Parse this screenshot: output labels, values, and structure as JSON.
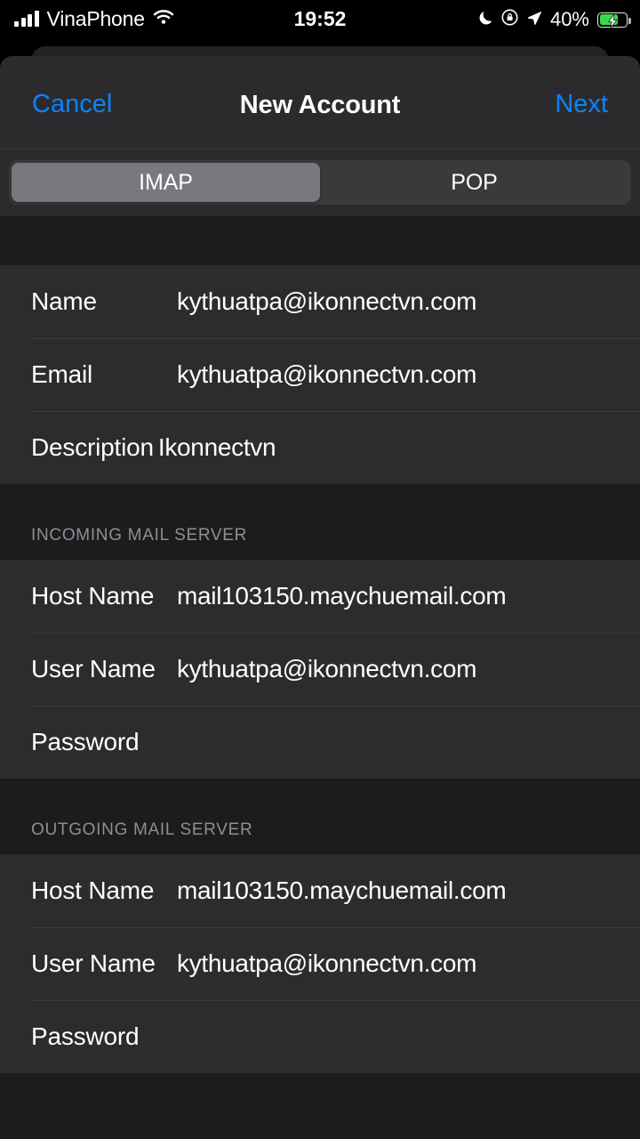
{
  "status_bar": {
    "carrier": "VinaPhone",
    "signal_icon": "signal-bars-icon",
    "wifi_icon": "wifi-icon",
    "time": "19:52",
    "do_not_disturb_icon": "crescent-moon-icon",
    "rotation_lock_icon": "rotation-lock-icon",
    "location_icon": "location-arrow-icon",
    "battery_percent": "40%",
    "battery_icon": "battery-charging-icon",
    "battery_level": 40,
    "battery_color": "#3ad94a"
  },
  "nav": {
    "cancel_label": "Cancel",
    "title": "New Account",
    "next_label": "Next",
    "accent_color": "#0a84ff"
  },
  "segmented": {
    "options": [
      {
        "label": "IMAP",
        "selected": true
      },
      {
        "label": "POP",
        "selected": false
      }
    ],
    "selected": "IMAP"
  },
  "form": {
    "groups": [
      {
        "header": "",
        "rows": [
          {
            "label": "Name",
            "value": "kythuatpa@ikonnectvn.com",
            "placeholder": "Name",
            "fixed_label": true
          },
          {
            "label": "Email",
            "value": "kythuatpa@ikonnectvn.com",
            "placeholder": "Email",
            "fixed_label": true
          },
          {
            "label": "Description",
            "value": "Ikonnectvn",
            "placeholder": "Description",
            "fixed_label": false
          }
        ]
      },
      {
        "header": "INCOMING MAIL SERVER",
        "rows": [
          {
            "label": "Host Name",
            "value": "mail103150.maychuemail.com",
            "placeholder": "Host Name",
            "fixed_label": true
          },
          {
            "label": "User Name",
            "value": "kythuatpa@ikonnectvn.com",
            "placeholder": "User Name",
            "fixed_label": true
          },
          {
            "label": "Password",
            "value": "",
            "placeholder": "Password",
            "fixed_label": true
          }
        ]
      },
      {
        "header": "OUTGOING MAIL SERVER",
        "rows": [
          {
            "label": "Host Name",
            "value": "mail103150.maychuemail.com",
            "placeholder": "Host Name",
            "fixed_label": true
          },
          {
            "label": "User Name",
            "value": "kythuatpa@ikonnectvn.com",
            "placeholder": "User Name",
            "fixed_label": true
          },
          {
            "label": "Password",
            "value": "",
            "placeholder": "Password",
            "fixed_label": true
          }
        ]
      }
    ]
  },
  "theme": {
    "background": "#000000",
    "sheet": "#1c1c1e",
    "navbar": "#2b2b2d",
    "cell": "#2c2c2e",
    "separator": "#3d3d40",
    "segment_track": "#3a3a3c",
    "segment_active": "#78787d",
    "label_gray": "#8e8e93",
    "accent": "#0a84ff"
  }
}
